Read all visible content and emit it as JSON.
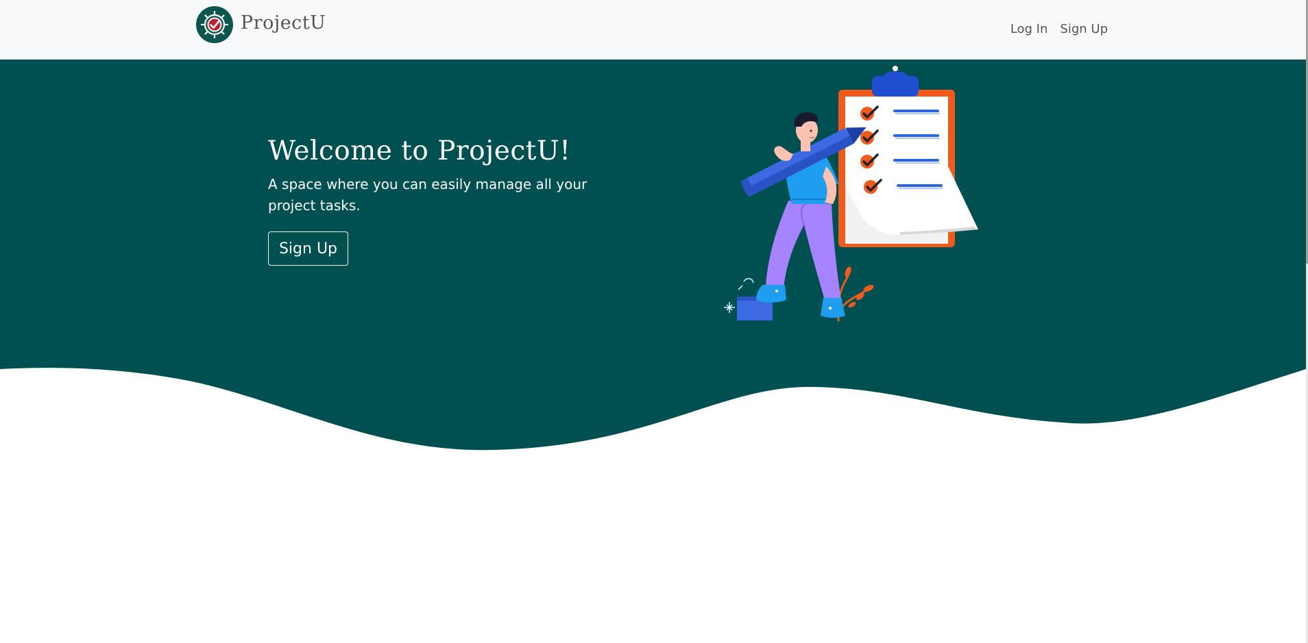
{
  "navbar": {
    "brand": {
      "name": "ProjectU",
      "logo_icon": "gear-checkmark-icon"
    },
    "links": [
      {
        "label": "Log In"
      },
      {
        "label": "Sign Up"
      }
    ]
  },
  "hero": {
    "title": "Welcome to ProjectU!",
    "subtitle": "A space where you can easily manage all your project tasks.",
    "cta_label": "Sign Up",
    "illustration": "person-with-pencil-and-checklist-illustration"
  },
  "colors": {
    "hero_background": "#005052",
    "navbar_background": "#f8f9fa",
    "page_background": "#ffffff",
    "accent_orange": "#f05a1a",
    "accent_blue": "#1f4fd0"
  }
}
